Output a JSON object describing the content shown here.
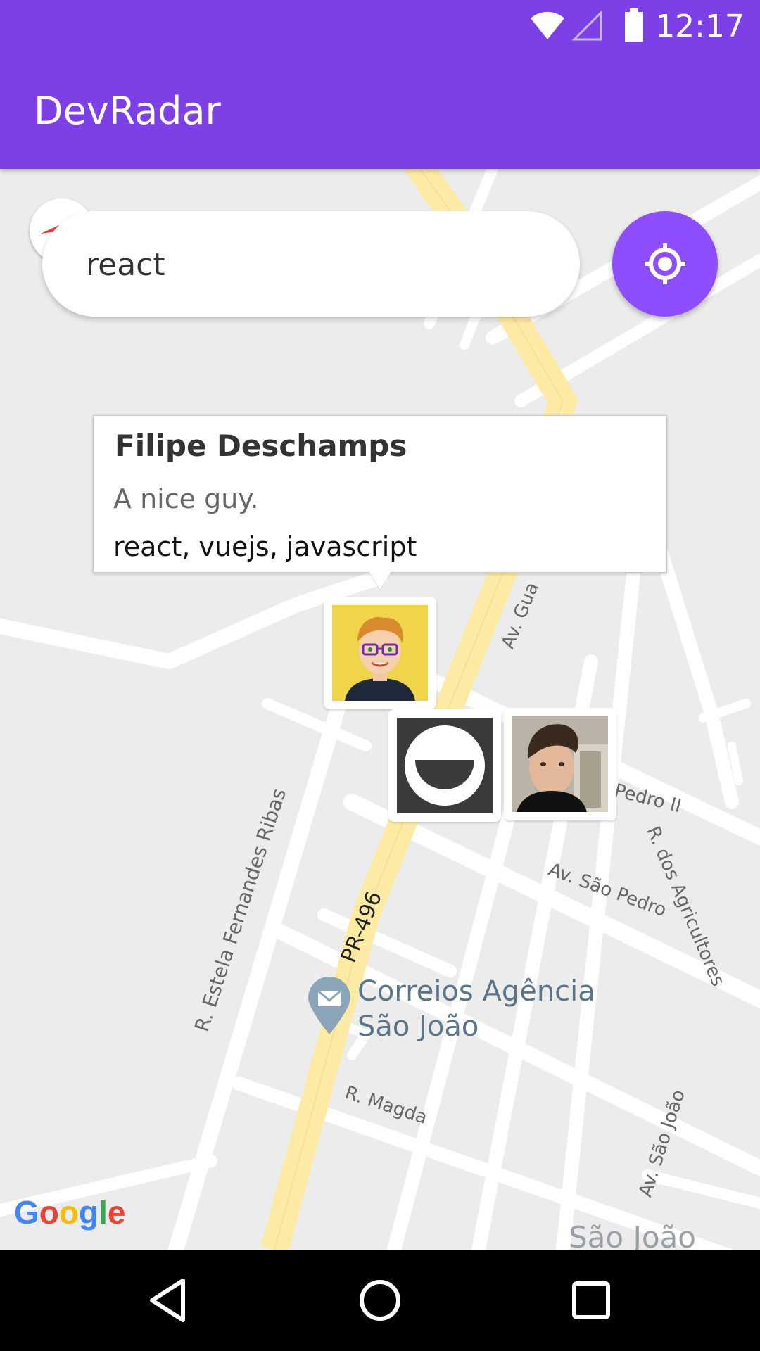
{
  "status_bar": {
    "time": "12:17"
  },
  "app": {
    "title": "DevRadar"
  },
  "search": {
    "value": "react",
    "placeholder": ""
  },
  "callout": {
    "name": "Filipe Deschamps",
    "bio": "A nice guy.",
    "techs": "react, vuejs, javascript"
  },
  "map": {
    "labels": {
      "av_gua": "Av. Gua",
      "pedro_ii": "Pedro II",
      "agricultores": "R. dos Agricultores",
      "sao_pedro": "Av. São Pedro",
      "estela": "R. Estela Fernandes Ribas",
      "pr496": "PR-496",
      "correios_1": "Correios Agência",
      "correios_2": "São João",
      "magda": "R. Magda",
      "av_sao_joao": "Av. São João",
      "city": "São João"
    },
    "attribution": "Google"
  },
  "colors": {
    "primary": "#7D40E7",
    "button": "#8E4DFF",
    "highway": "#FDEBA5",
    "map_bg": "#ECECEC",
    "road": "#FFFFFF"
  }
}
